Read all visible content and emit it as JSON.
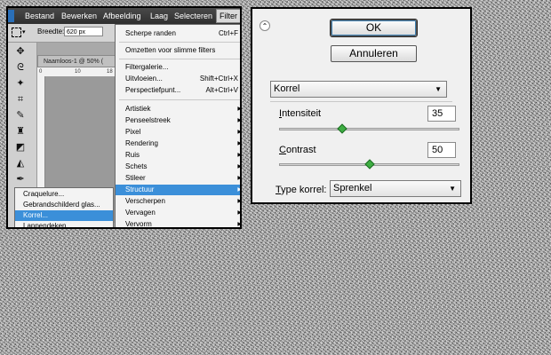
{
  "photoshop": {
    "menubar": [
      "Bestand",
      "Bewerken",
      "Afbeelding",
      "Laag",
      "Selecteren",
      "Filter"
    ],
    "options_bar": {
      "width_label": "Breedte:",
      "width_value": "620 px"
    },
    "doc_tab": "Naamloos-1 @ 50% (",
    "ruler_ticks": [
      "0",
      "10",
      "18"
    ],
    "filter_menu": {
      "items": [
        {
          "label": "Scherpe randen",
          "shortcut": "Ctrl+F"
        },
        {
          "label": "Omzetten voor slimme filters"
        },
        {
          "label": "Filtergalerie..."
        },
        {
          "label": "Uitvloeien...",
          "shortcut": "Shift+Ctrl+X"
        },
        {
          "label": "Perspectiefpunt...",
          "shortcut": "Alt+Ctrl+V"
        },
        {
          "label": "Artistiek",
          "submenu": true
        },
        {
          "label": "Penseelstreek",
          "submenu": true
        },
        {
          "label": "Pixel",
          "submenu": true
        },
        {
          "label": "Rendering",
          "submenu": true
        },
        {
          "label": "Ruis",
          "submenu": true
        },
        {
          "label": "Schets",
          "submenu": true
        },
        {
          "label": "Stileer",
          "submenu": true
        },
        {
          "label": "Structuur",
          "submenu": true,
          "highlighted": true
        },
        {
          "label": "Verscherpen",
          "submenu": true
        },
        {
          "label": "Vervagen",
          "submenu": true
        },
        {
          "label": "Vervorm",
          "submenu": true
        }
      ]
    },
    "structuur_submenu": {
      "items": [
        {
          "label": "Craquelure..."
        },
        {
          "label": "Gebrandschilderd glas..."
        },
        {
          "label": "Korrel...",
          "highlighted": true
        },
        {
          "label": "Lappendeken..."
        }
      ]
    }
  },
  "dialog": {
    "ok_label": "OK",
    "cancel_label": "Annuleren",
    "filter_select": "Korrel",
    "intensity": {
      "label_accel": "I",
      "label_rest": "ntensiteit",
      "value": "35",
      "slider_fraction": 0.35
    },
    "contrast": {
      "label_accel": "C",
      "label_rest": "ontrast",
      "value": "50",
      "slider_fraction": 0.5
    },
    "type_label_accel": "T",
    "type_label_rest": "ype korrel:",
    "type_select": "Sprenkel"
  },
  "colors": {
    "highlight": "#3b8fd9",
    "slider_thumb": "#3fae43"
  }
}
